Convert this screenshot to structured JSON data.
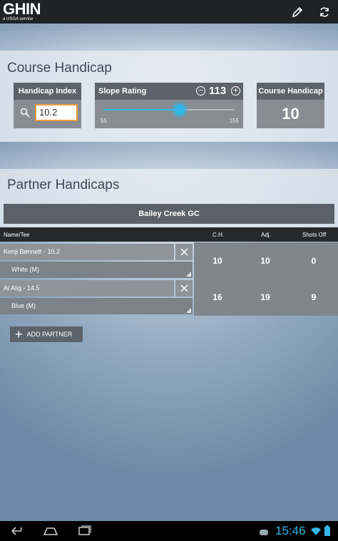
{
  "app": {
    "logo_text": "GHIN",
    "logo_sub": "a USGA service"
  },
  "actionbar": {
    "edit_icon": "pencil-icon",
    "refresh_icon": "refresh-icon"
  },
  "course_handicap": {
    "title": "Course Handicap",
    "index_label": "Handicap Index",
    "index_value": "10.2",
    "slope_label": "Slope Rating",
    "slope_value": "113",
    "slope_min": "55",
    "slope_max": "155",
    "slope_fraction": 0.58,
    "result_label": "Course Handicap",
    "result_value": "10"
  },
  "partners": {
    "title": "Partner Handicaps",
    "course_name": "Bailey Creek GC",
    "columns": [
      "Name/Tee",
      "C.H.",
      "Adj.",
      "Shots Off"
    ],
    "rows": [
      {
        "name": "Kenji Bennett - 10.2",
        "tee": "White (M)",
        "ch": "10",
        "adj": "10",
        "shots_off": "0"
      },
      {
        "name": "Al Alig - 14.5",
        "tee": "Blue (M)",
        "ch": "16",
        "adj": "19",
        "shots_off": "9"
      }
    ],
    "add_label": "ADD PARTNER"
  },
  "status": {
    "time": "15:46"
  },
  "colors": {
    "accent": "#33b5e5",
    "input_border": "#f09b3c",
    "header_dark": "#5d636a"
  }
}
